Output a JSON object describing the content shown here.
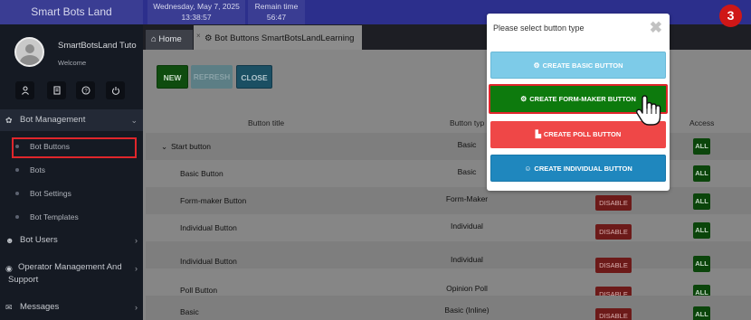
{
  "topbar": {
    "brand": "Smart Bots Land",
    "date": "Wednesday, May 7, 2025",
    "time": "13:38:57",
    "remain_label": "Remain time",
    "remain_value": "56:47"
  },
  "user": {
    "name": "SmartBotsLand Tuto",
    "welcome": "Welcome"
  },
  "quick_icons": [
    "user-icon",
    "document-icon",
    "help-icon",
    "power-icon"
  ],
  "sidebar": {
    "menu": [
      {
        "label": "Bot Management",
        "icon": "gear-icon"
      },
      {
        "label": "Bot Users",
        "icon": "users-icon"
      },
      {
        "label": "Operator Management And Support",
        "line1": "Operator Management And",
        "line2": "Support",
        "icon": "headset-icon"
      },
      {
        "label": "Messages",
        "icon": "envelope-icon"
      }
    ],
    "submenu": [
      {
        "label": "Bot Buttons"
      },
      {
        "label": "Bots"
      },
      {
        "label": "Bot Settings"
      },
      {
        "label": "Bot Templates"
      }
    ]
  },
  "tabs": {
    "home": "Home",
    "active": "Bot Buttons SmartBotsLandLearning"
  },
  "toolbar": {
    "new": "NEW",
    "refresh": "REFRESH",
    "close": "CLOSE"
  },
  "table": {
    "headers": {
      "title": "Button title",
      "type": "Button typ",
      "access": "Access"
    },
    "rows": [
      {
        "title": "Start button",
        "type": "Basic",
        "access": "ALL"
      },
      {
        "title": "Basic Button",
        "type": "Basic",
        "access": "ALL"
      },
      {
        "title": "Form-maker Button",
        "type": "Form-Maker",
        "status": "DISABLE",
        "access": "ALL"
      },
      {
        "title": "Individual Button",
        "type": "Individual",
        "status": "DISABLE",
        "access": "ALL"
      },
      {
        "title": "Individual Button",
        "type": "Individual",
        "status": "DISABLE",
        "access": "ALL"
      },
      {
        "title": "Poll Button",
        "type": "Opinion Poll",
        "status": "DISABLE",
        "access": "ALL"
      },
      {
        "title": "Basic",
        "type": "Basic (Inline)",
        "status": "DISABLE",
        "access": "ALL"
      }
    ]
  },
  "modal": {
    "title": "Please select button type",
    "buttons": {
      "basic": "CREATE BASIC BUTTON",
      "form": "CREATE FORM-MAKER BUTTON",
      "poll": "CREATE POLL BUTTON",
      "individual": "CREATE INDIVIDUAL BUTTON"
    }
  },
  "step_number": "3",
  "colors": {
    "topbar": "#2c2f8c",
    "sidebar": "#151a23",
    "highlight": "#e0262b",
    "green": "#0d7a0d",
    "poll_red": "#ef4747",
    "blue": "#1f87be",
    "light_blue": "#7dcbe8"
  }
}
